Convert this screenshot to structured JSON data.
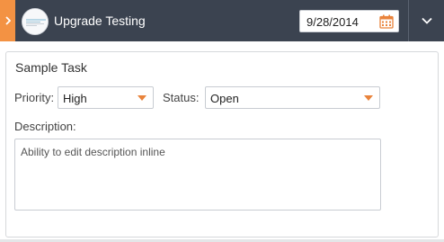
{
  "header": {
    "title": "Upgrade Testing",
    "date": "9/28/2014",
    "collapse_icon": "chevron-right-icon",
    "calendar_icon": "calendar-icon",
    "expand_icon": "chevron-down-icon",
    "colors": {
      "bar": "#3b4350",
      "accent": "#f39243"
    }
  },
  "task": {
    "title": "Sample Task",
    "priority_label": "Priority:",
    "priority_value": "High",
    "status_label": "Status:",
    "status_value": "Open",
    "description_label": "Description:",
    "description_value": "Ability to edit description inline"
  }
}
